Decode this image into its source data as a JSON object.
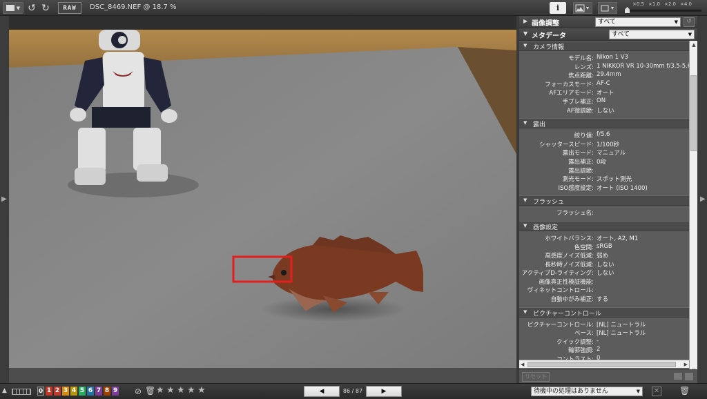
{
  "topbar": {
    "raw_label": "RAW",
    "filename": "DSC_8469.NEF @ 18.7 %",
    "info_label": "i",
    "zoom_levels": [
      "×0.5",
      "×1.0",
      "×2.0",
      "×4.0"
    ]
  },
  "panel": {
    "adjust": {
      "title": "画像調整",
      "value": "すべて"
    },
    "metadata": {
      "title": "メタデータ",
      "value": "すべて"
    },
    "sections": [
      {
        "title": "カメラ情報",
        "rows": [
          {
            "k": "モデル名:",
            "v": "Nikon 1 V3"
          },
          {
            "k": "レンズ:",
            "v": "1 NIKKOR VR 10-30mm f/3.5-5.6 PD"
          },
          {
            "k": "焦点距離:",
            "v": "29.4mm"
          },
          {
            "k": "フォーカスモード:",
            "v": "AF-C"
          },
          {
            "k": "AFエリアモード:",
            "v": "オート"
          },
          {
            "k": "手ブレ補正:",
            "v": "ON"
          },
          {
            "k": "AF微調節:",
            "v": "しない"
          }
        ]
      },
      {
        "title": "露出",
        "rows": [
          {
            "k": "絞り値:",
            "v": "f/5.6"
          },
          {
            "k": "シャッタースピード:",
            "v": "1/100秒"
          },
          {
            "k": "露出モード:",
            "v": "マニュアル"
          },
          {
            "k": "露出補正:",
            "v": "0段"
          },
          {
            "k": "露出調節:",
            "v": ""
          },
          {
            "k": "測光モード:",
            "v": "スポット測光"
          },
          {
            "k": "ISO感度設定:",
            "v": "オート (ISO 1400)"
          }
        ]
      },
      {
        "title": "フラッシュ",
        "rows": [
          {
            "k": "フラッシュ名:",
            "v": ""
          }
        ]
      },
      {
        "title": "画像設定",
        "rows": [
          {
            "k": "ホワイトバランス:",
            "v": "オート, A2, M1"
          },
          {
            "k": "色空間:",
            "v": "sRGB"
          },
          {
            "k": "高感度ノイズ低減:",
            "v": "弱め"
          },
          {
            "k": "長秒時ノイズ低減:",
            "v": "しない"
          },
          {
            "k": "アクティブD-ライティング:",
            "v": "しない"
          },
          {
            "k": "画像真正性検証機能:",
            "v": ""
          },
          {
            "k": "ヴィネットコントロール:",
            "v": ""
          },
          {
            "k": "自動ゆがみ補正:",
            "v": "する"
          }
        ]
      },
      {
        "title": "ピクチャーコントロール",
        "rows": [
          {
            "k": "ピクチャーコントロール:",
            "v": "[NL] ニュートラル"
          },
          {
            "k": "ベース:",
            "v": "[NL] ニュートラル"
          },
          {
            "k": "クイック調整:",
            "v": "-"
          },
          {
            "k": "輪郭強調:",
            "v": "2"
          },
          {
            "k": "コントラスト:",
            "v": "0"
          }
        ]
      }
    ],
    "reset_label": "リセット"
  },
  "bottombar": {
    "labels": [
      "0",
      "1",
      "2",
      "3",
      "4",
      "5",
      "6",
      "7",
      "8",
      "9"
    ],
    "label_colors": [
      "#444444",
      "#c0392b",
      "#c0392b",
      "#d68910",
      "#b7950b",
      "#27ae60",
      "#2471a3",
      "#7d3c98",
      "#a04000",
      "#7d3c98"
    ],
    "counter": "86 / 87",
    "queue_status": "待機中の処理はありません"
  },
  "colors": {
    "highlight_box": "#e31e1e"
  }
}
